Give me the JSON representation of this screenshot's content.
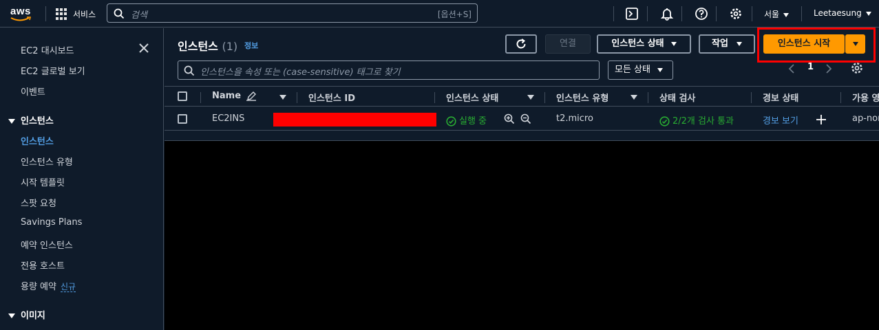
{
  "nav": {
    "logo": "aws",
    "services": "서비스",
    "search_placeholder": "검색",
    "search_shortcut": "[옵션+S]",
    "region": "서울",
    "user": "Leetaesung",
    "icons": [
      "cloudshell-icon",
      "bell-icon",
      "help-icon",
      "settings-icon"
    ]
  },
  "sidebar": {
    "items_top": [
      "EC2 대시보드",
      "EC2 글로벌 보기",
      "이벤트"
    ],
    "section_instances": "인스턴스",
    "instances_items": [
      "인스턴스",
      "인스턴스 유형",
      "시작 템플릿",
      "스팟 요청",
      "Savings Plans",
      "예약 인스턴스",
      "전용 호스트",
      "용량 예약"
    ],
    "new_badge": "신규",
    "section_images": "이미지"
  },
  "main": {
    "title": "인스턴스",
    "count": "(1)",
    "info": "정보",
    "buttons": {
      "connect": "연결",
      "instance_state": "인스턴스 상태",
      "actions": "작업",
      "launch": "인스턴스 시작"
    },
    "filter_placeholder": "인스턴스을 속성 또는 (case-sensitive) 태그로 찾기",
    "state_filter": "모든 상태",
    "page": "1"
  },
  "table": {
    "columns": [
      "Name",
      "인스턴스 ID",
      "인스턴스 상태",
      "인스턴스 유형",
      "상태 검사",
      "경보 상태",
      "가용 영"
    ],
    "rows": [
      {
        "name": "EC2INS",
        "state": "실행 중",
        "type": "t2.micro",
        "status_check": "2/2개 검사 통과",
        "alarm": "경보 보기",
        "az": "ap-nor"
      }
    ]
  },
  "colors": {
    "accent": "#539fe5",
    "primary": "#ff9900",
    "success": "#29ad32",
    "background": "#0f1b2a"
  }
}
